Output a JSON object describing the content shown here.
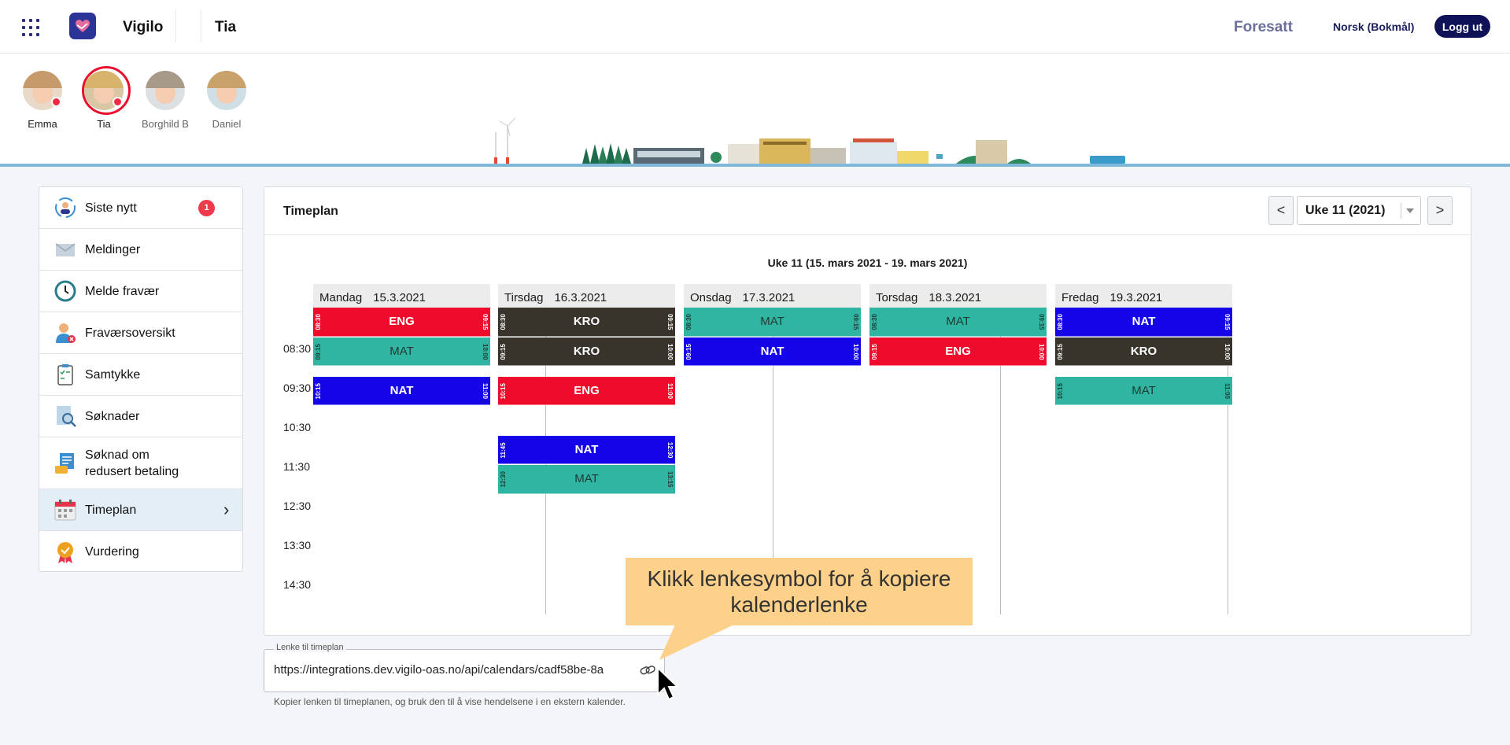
{
  "header": {
    "app_name": "Vigilo",
    "child_name": "Tia",
    "role": "Foresatt",
    "language": "Norsk (Bokmål)",
    "logout": "Logg ut"
  },
  "children": [
    {
      "name": "Emma",
      "has_notification": true
    },
    {
      "name": "Tia",
      "selected": true,
      "has_notification": true
    },
    {
      "name": "Borghild B"
    },
    {
      "name": "Daniel"
    }
  ],
  "menu": {
    "items": [
      {
        "label": "Siste nytt",
        "icon": "news-icon",
        "badge": "1"
      },
      {
        "label": "Meldinger",
        "icon": "envelope-icon"
      },
      {
        "label": "Melde fravær",
        "icon": "clock-icon"
      },
      {
        "label": "Fraværsoversikt",
        "icon": "person-absence-icon"
      },
      {
        "label": "Samtykke",
        "icon": "clipboard-check-icon"
      },
      {
        "label": "Søknader",
        "icon": "document-search-icon"
      },
      {
        "label": "Søknad om redusert betaling",
        "icon": "payment-form-icon"
      },
      {
        "label": "Timeplan",
        "icon": "calendar-icon",
        "active": true
      },
      {
        "label": "Vurdering",
        "icon": "medal-icon"
      }
    ]
  },
  "timetable": {
    "title": "Timeplan",
    "prev": "<",
    "next": ">",
    "week_label": "Uke 11 (2021)",
    "week_range": "Uke 11 (15. mars 2021 - 19. mars 2021)",
    "times": [
      "08:30",
      "09:30",
      "10:30",
      "11:30",
      "12:30",
      "13:30",
      "14:30"
    ],
    "days": [
      {
        "name": "Mandag",
        "date": "15.3.2021",
        "lessons": [
          {
            "subject": "ENG",
            "start": "08:30",
            "end": "09:15",
            "color": "#ee0b2b"
          },
          {
            "subject": "MAT",
            "start": "09:15",
            "end": "10:00",
            "color": "#2fb5a2"
          },
          {
            "subject": "NAT",
            "start": "10:15",
            "end": "11:00",
            "color": "#1504e8"
          }
        ]
      },
      {
        "name": "Tirsdag",
        "date": "16.3.2021",
        "lessons": [
          {
            "subject": "KRO",
            "start": "08:30",
            "end": "09:15",
            "color": "#38342c"
          },
          {
            "subject": "KRO",
            "start": "09:15",
            "end": "10:00",
            "color": "#38342c"
          },
          {
            "subject": "ENG",
            "start": "10:15",
            "end": "11:00",
            "color": "#ee0b2b"
          },
          {
            "subject": "NAT",
            "start": "11:45",
            "end": "12:30",
            "color": "#1504e8"
          },
          {
            "subject": "MAT",
            "start": "12:30",
            "end": "13:15",
            "color": "#2fb5a2"
          }
        ]
      },
      {
        "name": "Onsdag",
        "date": "17.3.2021",
        "lessons": [
          {
            "subject": "MAT",
            "start": "08:30",
            "end": "09:15",
            "color": "#2fb5a2"
          },
          {
            "subject": "NAT",
            "start": "09:15",
            "end": "10:00",
            "color": "#1504e8"
          }
        ]
      },
      {
        "name": "Torsdag",
        "date": "18.3.2021",
        "lessons": [
          {
            "subject": "MAT",
            "start": "08:30",
            "end": "09:15",
            "color": "#2fb5a2"
          },
          {
            "subject": "ENG",
            "start": "09:15",
            "end": "10:00",
            "color": "#ee0b2b"
          }
        ]
      },
      {
        "name": "Fredag",
        "date": "19.3.2021",
        "lessons": [
          {
            "subject": "NAT",
            "start": "08:30",
            "end": "09:15",
            "color": "#1504e8"
          },
          {
            "subject": "KRO",
            "start": "09:15",
            "end": "10:00",
            "color": "#38342c"
          },
          {
            "subject": "MAT",
            "start": "10:15",
            "end": "11:00",
            "color": "#2fb5a2"
          }
        ]
      }
    ]
  },
  "link_field": {
    "legend": "Lenke til timeplan",
    "value": "https://integrations.dev.vigilo-oas.no/api/calendars/cadf58be-8a",
    "helper": "Kopier lenken til timeplanen, og bruk den til å vise hendelsene i en ekstern kalender.",
    "icon": "link-icon"
  },
  "callout": {
    "line1": "Klikk lenkesymbol for å kopiere",
    "line2": "kalenderlenke"
  }
}
